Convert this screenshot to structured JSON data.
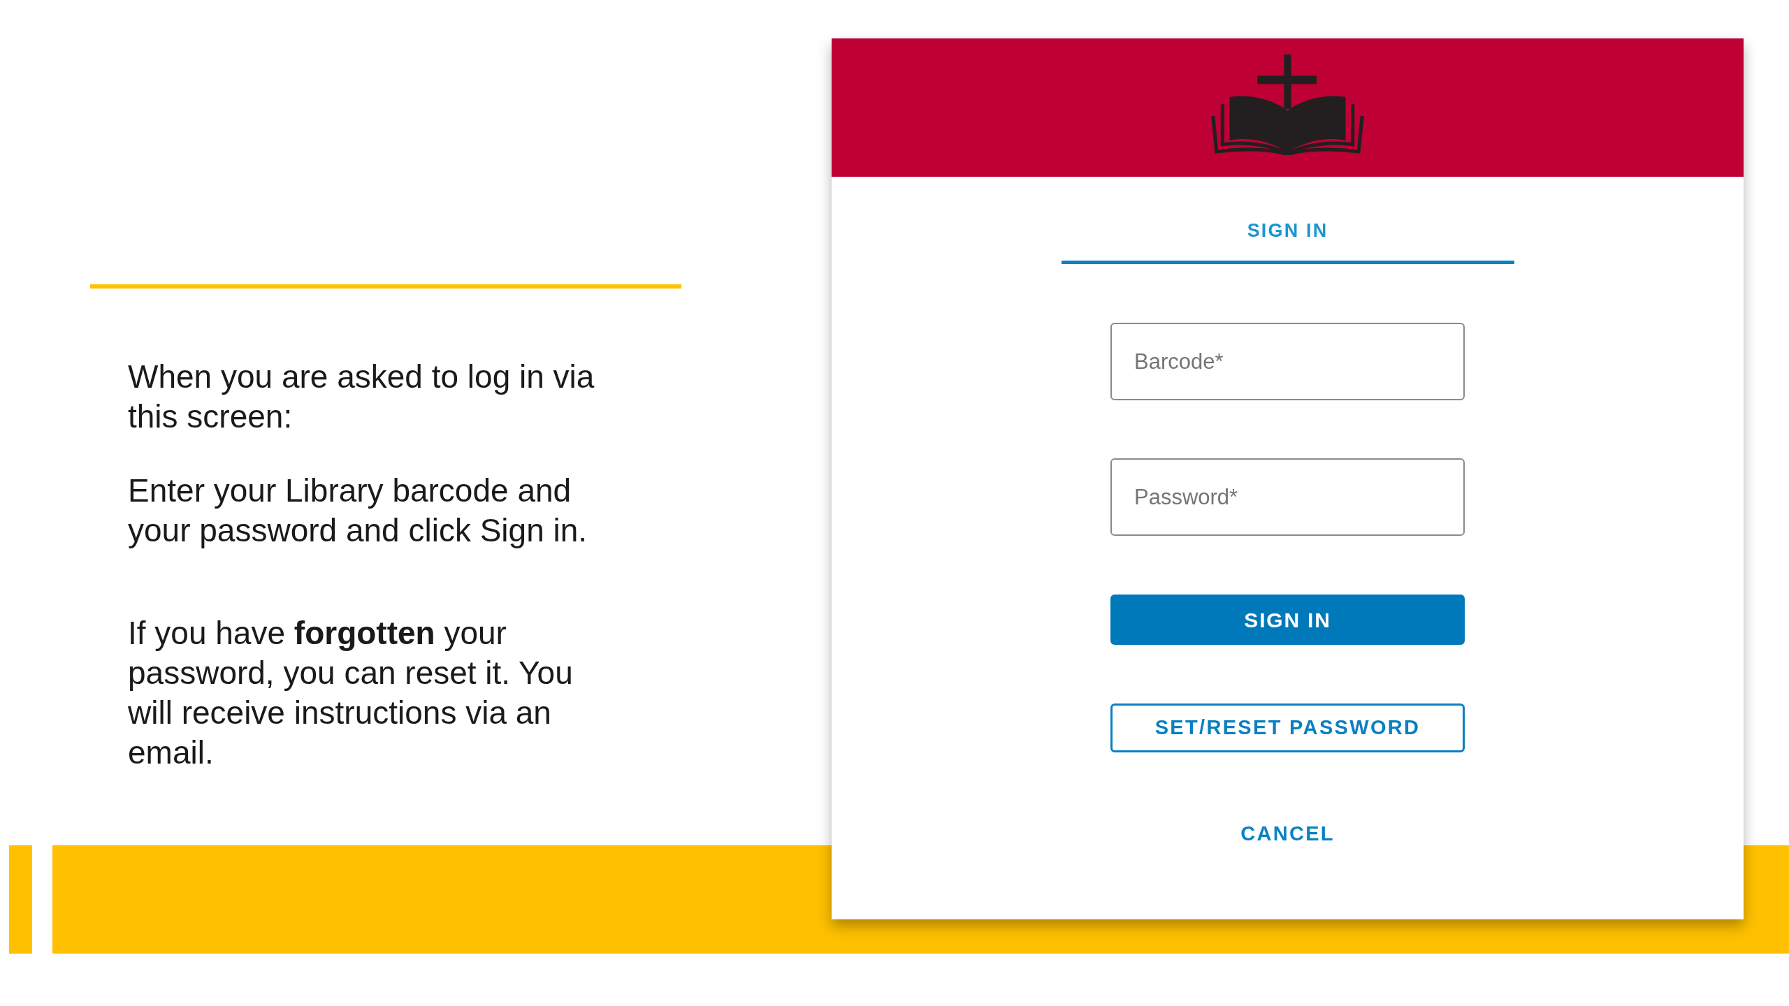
{
  "slide": {
    "instructions": [
      "When you are asked to log in via this screen:",
      "Enter your Library barcode and your password and click Sign in.",
      "If you have **forgotten** your password, you can reset it. You will receive instructions via an email."
    ]
  },
  "login_dialog": {
    "tabs": [
      {
        "label": "SIGN IN",
        "selected": true
      }
    ],
    "fields": [
      {
        "placeholder": "Barcode*"
      },
      {
        "placeholder": "Password*"
      }
    ],
    "buttons": [
      {
        "label": "SIGN IN",
        "kind": "primary"
      },
      {
        "label": "SET/RESET PASSWORD",
        "kind": "outlined"
      },
      {
        "label": "CANCEL",
        "kind": "text"
      }
    ]
  }
}
